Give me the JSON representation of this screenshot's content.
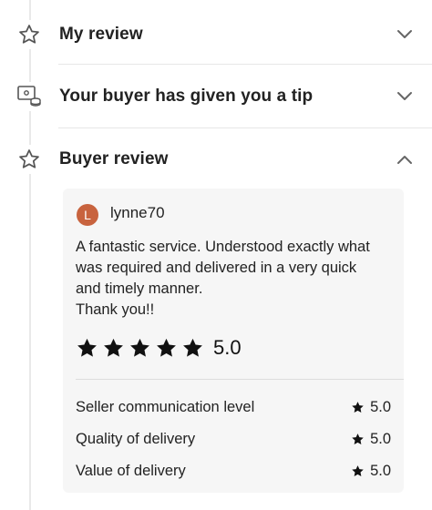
{
  "sections": [
    {
      "title": "My review",
      "icon": "star-outline-icon",
      "state": "collapsed"
    },
    {
      "title": "Your buyer has given you a tip",
      "icon": "tip-money-icon",
      "state": "collapsed"
    },
    {
      "title": "Buyer review",
      "icon": "star-outline-icon",
      "state": "expanded"
    }
  ],
  "review": {
    "avatar_initial": "L",
    "username": "lynne70",
    "text_lines": [
      "A fantastic service. Understood exactly what",
      "was required and delivered in a very quick",
      "and timely manner.",
      "Thank you!!"
    ],
    "star_count": 5,
    "overall_rating": "5.0",
    "breakdown": [
      {
        "label": "Seller communication level",
        "value": "5.0"
      },
      {
        "label": "Quality of delivery",
        "value": "5.0"
      },
      {
        "label": "Value of delivery",
        "value": "5.0"
      }
    ]
  },
  "colors": {
    "avatar": "#c8633e",
    "card_bg": "#f6f6f6",
    "divider": "#e7e7e7"
  }
}
